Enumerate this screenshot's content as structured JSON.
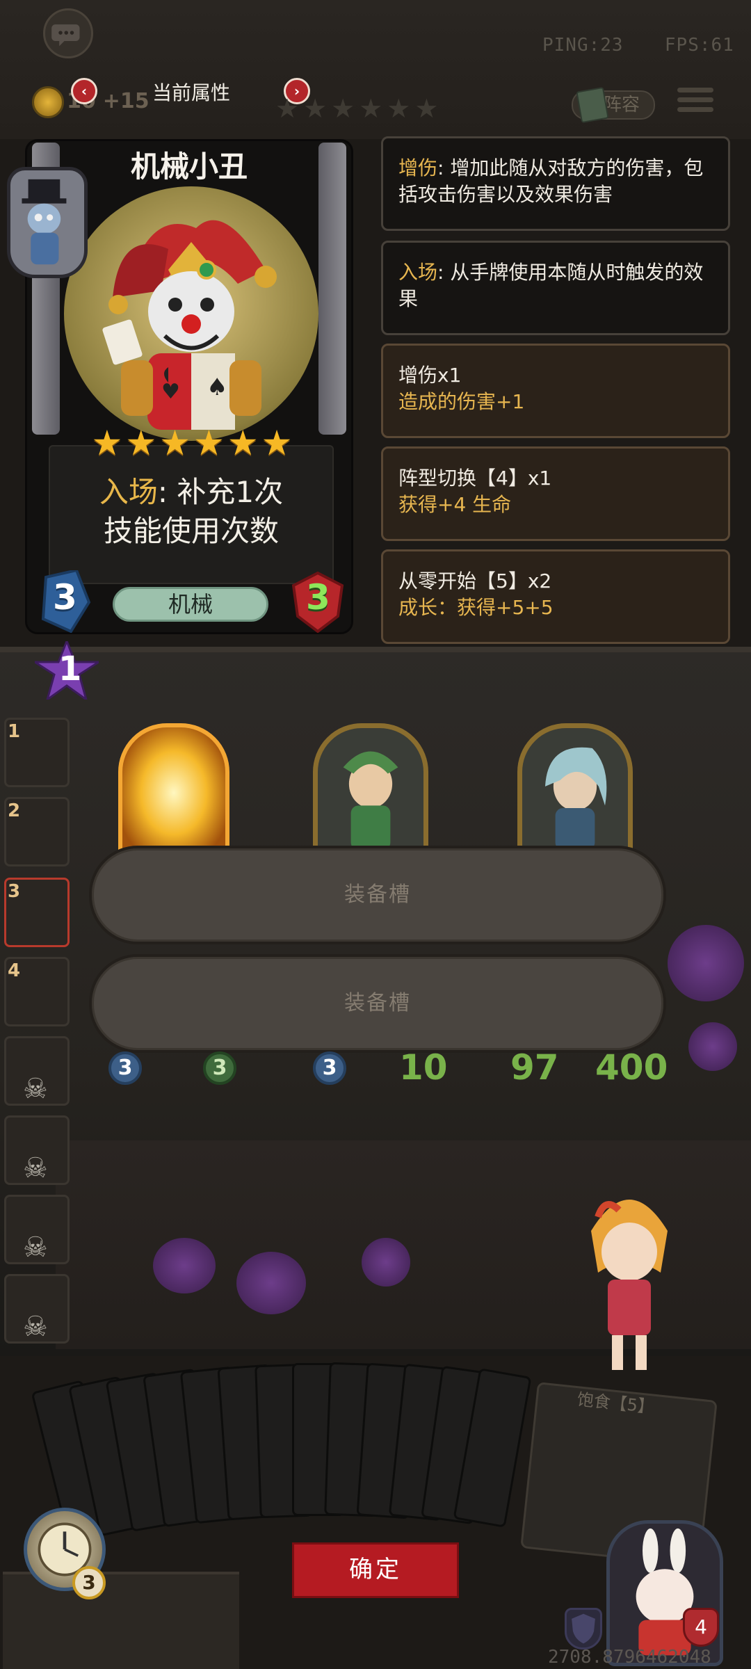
{
  "hud": {
    "ping": "PING:23",
    "fps": "FPS:61",
    "gold": "10",
    "gold_income": "+15",
    "attr_title": "当前属性",
    "prev_arrow": "‹",
    "next_arrow": "›",
    "hud_stars": "★★★★★★",
    "lineup_label": "阵容"
  },
  "card": {
    "name": "机械小丑",
    "stars": "★★★★★★",
    "effect_keyword": "入场",
    "effect_line1_rest": ": 补充1次",
    "effect_line2": "技能使用次数",
    "cost": "3",
    "health": "3",
    "tribe": "机械"
  },
  "info_panels": [
    {
      "keyword": "增伤",
      "text": ": 增加此随从对敌方的伤害，包括攻击伤害以及效果伤害"
    },
    {
      "keyword": "入场",
      "text": ": 从手牌使用本随从时触发的效果"
    },
    {
      "title": "增伤x1",
      "detail": "造成的伤害+1"
    },
    {
      "title": "阵型切换【4】x1",
      "detail": "获得+4 生命"
    },
    {
      "title": "从零开始【5】x2",
      "detail": "成长：获得+5+5"
    }
  ],
  "field": {
    "level": "1",
    "sidebar_slots": [
      "1",
      "2",
      "3",
      "4"
    ],
    "equip_slot_label": "装备槽",
    "minions": [
      {
        "atk": "3",
        "hp": "3"
      },
      {
        "atk": "3",
        "hp": "10"
      },
      {
        "atk": "97",
        "hp": "400"
      }
    ]
  },
  "bottom": {
    "hunger_label": "饱食【5】",
    "confirm_label": "确定",
    "clock_count": "3",
    "hero_count": "4",
    "coords": "2708.8796462048"
  },
  "colors": {
    "accent_gold": "#e7b650",
    "confirm_red": "#b51b22",
    "star": "#f6b825",
    "tribe_green": "#9cc1ac"
  }
}
